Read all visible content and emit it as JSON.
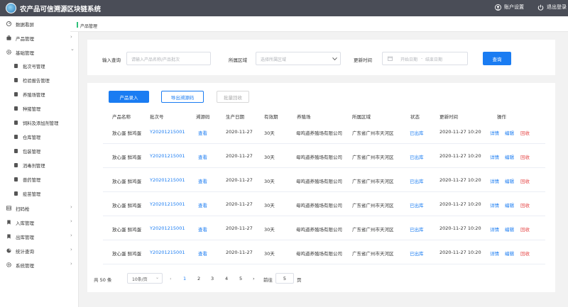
{
  "header": {
    "title": "农产品可信溯源区块链系统",
    "logo_icon": "globe-icon",
    "account_label": "账户设置",
    "logout_label": "退出登录"
  },
  "sidebar": {
    "items": [
      {
        "label": "数据看屏",
        "icon": "dashboard-icon",
        "arrow": ""
      },
      {
        "label": "产品管理",
        "icon": "briefcase-icon",
        "arrow": "›"
      },
      {
        "label": "基础管理",
        "icon": "gear-icon",
        "arrow": "⌄"
      }
    ],
    "sub_items": [
      {
        "label": "批次号管理"
      },
      {
        "label": "检验报告管理"
      },
      {
        "label": "养殖场管理"
      },
      {
        "label": "种猪管理"
      },
      {
        "label": "饲料及添加剂管理"
      },
      {
        "label": "仓库管理"
      },
      {
        "label": "包装管理"
      },
      {
        "label": "消毒剂管理"
      },
      {
        "label": "兽药管理"
      },
      {
        "label": "疫苗管理"
      }
    ],
    "bottom_items": [
      {
        "label": "扫码枪",
        "icon": "scanner-icon",
        "arrow": "›"
      },
      {
        "label": "入库管理",
        "icon": "bookmark-icon",
        "arrow": "›"
      },
      {
        "label": "出库管理",
        "icon": "bookmark-icon",
        "arrow": "›"
      },
      {
        "label": "统计查询",
        "icon": "pie-chart-icon",
        "arrow": "›"
      },
      {
        "label": "系统管理",
        "icon": "gear-icon",
        "arrow": "›"
      }
    ]
  },
  "breadcrumb": {
    "current": "产品管理"
  },
  "filters": {
    "query_label": "输入查询",
    "query_placeholder": "请输入产品名称/产品批次",
    "region_label": "所属区域",
    "region_placeholder": "选择所属区域",
    "date_label": "更新时间",
    "date_start_placeholder": "开始日期",
    "date_separator": "-",
    "date_end_placeholder": "结束日期",
    "query_button": "查询"
  },
  "toolbar": {
    "add_label": "产品录入",
    "export_label": "导出溯源码",
    "recall_label": "批量回收"
  },
  "table": {
    "columns": [
      "产品名称",
      "批次号",
      "溯源码",
      "生产日期",
      "有效期",
      "养殖场",
      "所属区域",
      "状态",
      "更新时间",
      "操作"
    ],
    "rows": [
      {
        "name": "放心蛋 鲜鸡蛋",
        "batch": "Y20201215001",
        "code": "查看",
        "date": "2020-11-27",
        "validity": "30天",
        "farm": "母鸡道养殖场有限公司",
        "region": "广东省广州市天河区",
        "status": "已出库",
        "updated": "2020-11-27 10:20",
        "detail": "详情",
        "edit": "编辑",
        "recall": "回收"
      },
      {
        "name": "放心蛋 鲜鸡蛋",
        "batch": "Y20201215001",
        "code": "查看",
        "date": "2020-11-27",
        "validity": "30天",
        "farm": "母鸡道养殖场有限公司",
        "region": "广东省广州市天河区",
        "status": "已出库",
        "updated": "2020-11-27 10:20",
        "detail": "详情",
        "edit": "编辑",
        "recall": "回收"
      },
      {
        "name": "放心蛋 鲜鸡蛋",
        "batch": "Y20201215001",
        "code": "查看",
        "date": "2020-11-27",
        "validity": "30天",
        "farm": "母鸡道养殖场有限公司",
        "region": "广东省广州市天河区",
        "status": "已出库",
        "updated": "2020-11-27 10:20",
        "detail": "详情",
        "edit": "编辑",
        "recall": "回收"
      },
      {
        "name": "放心蛋 鲜鸡蛋",
        "batch": "Y20201215001",
        "code": "查看",
        "date": "2020-11-27",
        "validity": "30天",
        "farm": "母鸡道养殖场有限公司",
        "region": "广东省广州市天河区",
        "status": "已出库",
        "updated": "2020-11-27 10:20",
        "detail": "详情",
        "edit": "编辑",
        "recall": "回收"
      },
      {
        "name": "放心蛋 鲜鸡蛋",
        "batch": "Y20201215001",
        "code": "查看",
        "date": "2020-11-27",
        "validity": "30天",
        "farm": "母鸡道养殖场有限公司",
        "region": "广东省广州市天河区",
        "status": "已出库",
        "updated": "2020-11-27 10:20",
        "detail": "详情",
        "edit": "编辑",
        "recall": "回收"
      },
      {
        "name": "放心蛋 鲜鸡蛋",
        "batch": "Y20201215001",
        "code": "查看",
        "date": "2020-11-27",
        "validity": "30天",
        "farm": "母鸡道养殖场有限公司",
        "region": "广东省广州市天河区",
        "status": "已出库",
        "updated": "2020-11-27 10:20",
        "detail": "详情",
        "edit": "编辑",
        "recall": "回收"
      }
    ]
  },
  "pagination": {
    "total": "共 50 条",
    "page_size": "10条/页",
    "prev": "‹",
    "pages": [
      "1",
      "2",
      "3",
      "4",
      "5"
    ],
    "current_page": "1",
    "next": "›",
    "goto_label": "前往",
    "goto_value": "5",
    "page_unit": "页"
  },
  "colors": {
    "header_bg": "#4a4d57",
    "primary": "#1a7cf2",
    "danger": "#e54545",
    "breadcrumb_accent": "#2ec07a"
  }
}
